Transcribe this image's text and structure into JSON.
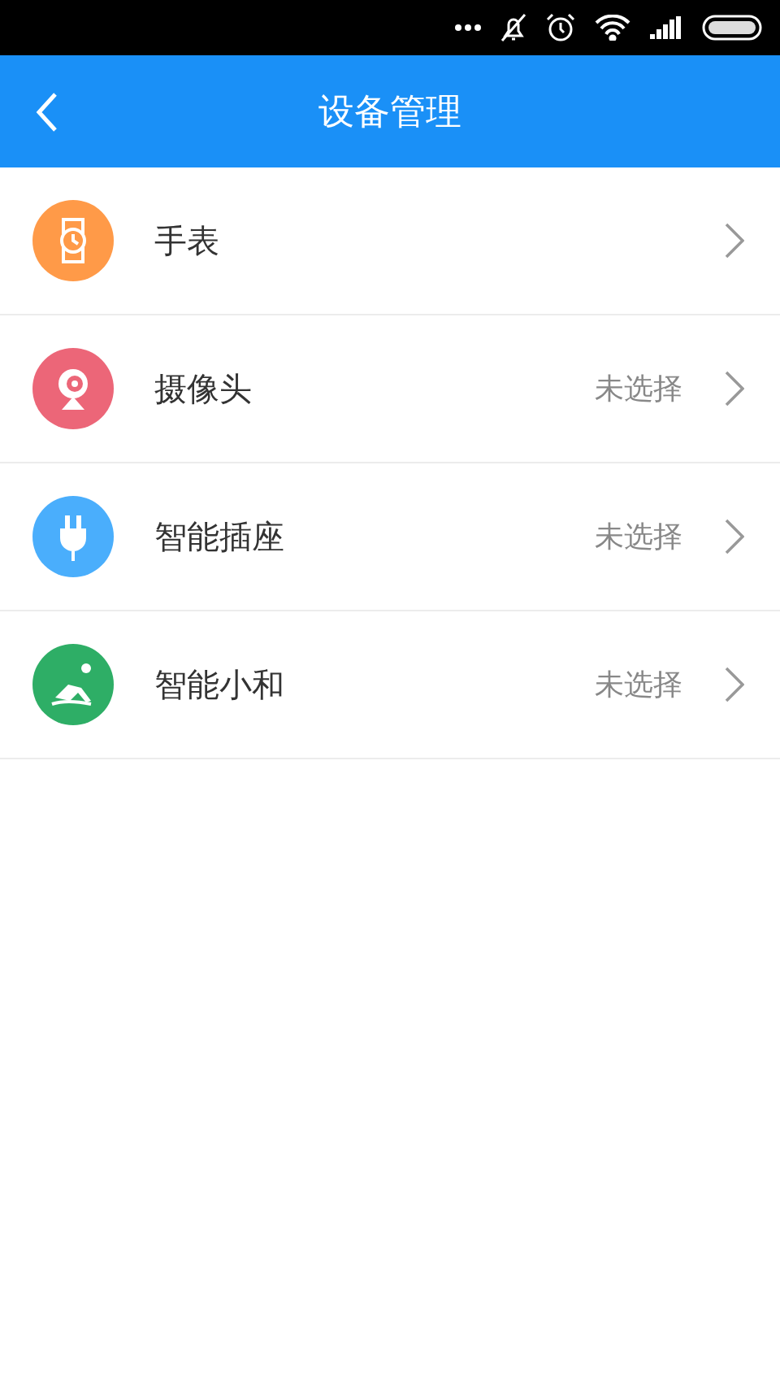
{
  "header": {
    "title": "设备管理"
  },
  "devices": [
    {
      "kind": "watch",
      "name": "手表",
      "color": "#ff9a48"
    },
    {
      "kind": "camera",
      "name": "摄像头",
      "status": "未选择",
      "color": "#ec6678"
    },
    {
      "kind": "plug",
      "name": "智能插座",
      "status": "未选择",
      "color": "#4aaefc"
    },
    {
      "kind": "person",
      "name": "智能小和",
      "status": "未选择",
      "color": "#2eae66"
    }
  ]
}
